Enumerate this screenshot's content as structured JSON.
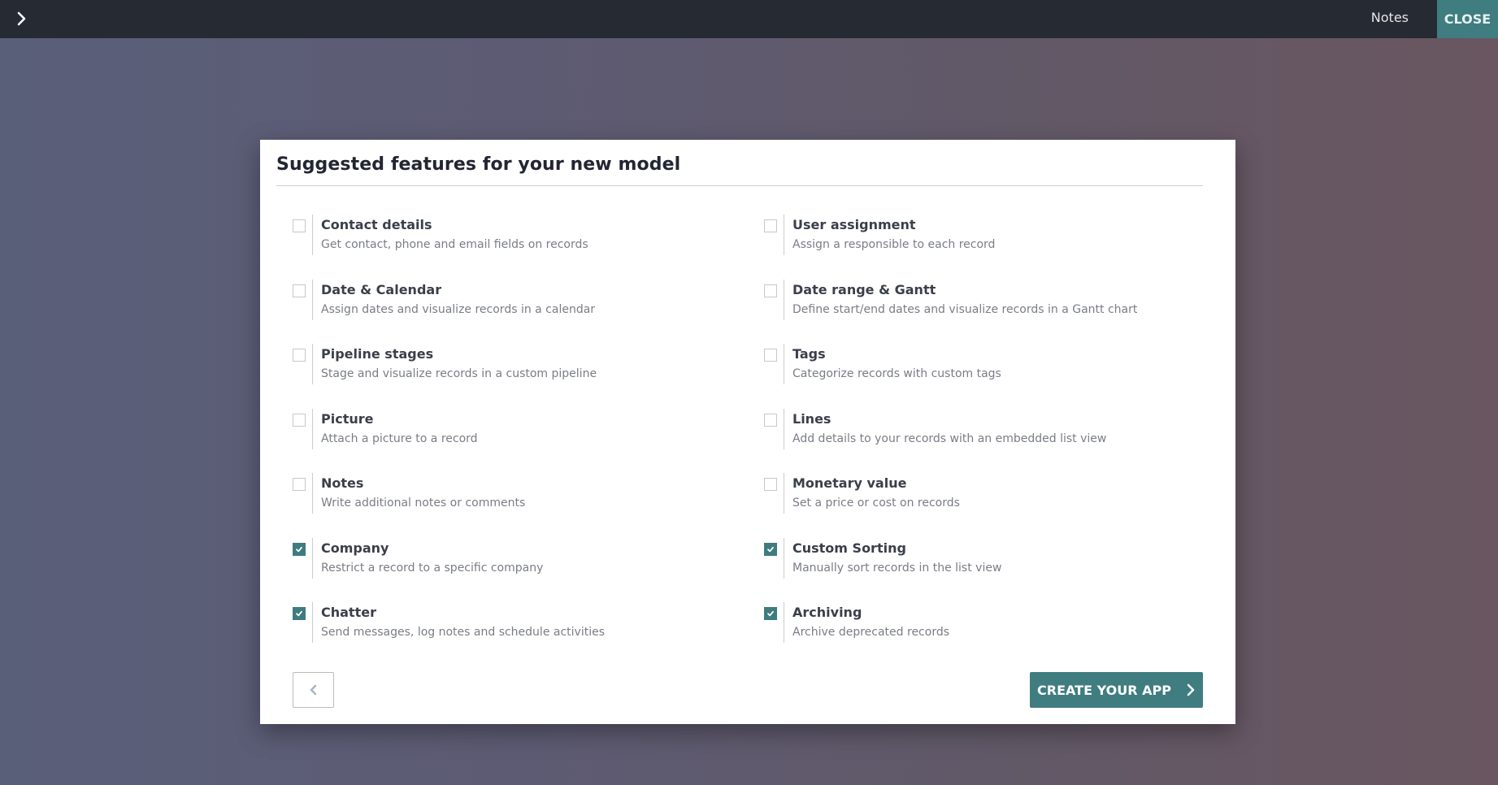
{
  "topbar": {
    "toggle_icon": "chevron-right-icon",
    "notes_label": "Notes",
    "close_label": "CLOSE"
  },
  "modal": {
    "title": "Suggested features for your new model",
    "features_left": [
      {
        "title": "Contact details",
        "description": "Get contact, phone and email fields on records",
        "checked": false
      },
      {
        "title": "Date & Calendar",
        "description": "Assign dates and visualize records in a calendar",
        "checked": false
      },
      {
        "title": "Pipeline stages",
        "description": "Stage and visualize records in a custom pipeline",
        "checked": false
      },
      {
        "title": "Picture",
        "description": "Attach a picture to a record",
        "checked": false
      },
      {
        "title": "Notes",
        "description": "Write additional notes or comments",
        "checked": false
      },
      {
        "title": "Company",
        "description": "Restrict a record to a specific company",
        "checked": true
      },
      {
        "title": "Chatter",
        "description": "Send messages, log notes and schedule activities",
        "checked": true
      }
    ],
    "features_right": [
      {
        "title": "User assignment",
        "description": "Assign a responsible to each record",
        "checked": false
      },
      {
        "title": "Date range & Gantt",
        "description": "Define start/end dates and visualize records in a Gantt chart",
        "checked": false
      },
      {
        "title": "Tags",
        "description": "Categorize records with custom tags",
        "checked": false
      },
      {
        "title": "Lines",
        "description": "Add details to your records with an embedded list view",
        "checked": false
      },
      {
        "title": "Monetary value",
        "description": "Set a price or cost on records",
        "checked": false
      },
      {
        "title": "Custom Sorting",
        "description": "Manually sort records in the list view",
        "checked": true
      },
      {
        "title": "Archiving",
        "description": "Archive deprecated records",
        "checked": true
      }
    ],
    "back_icon": "chevron-left-icon",
    "create_label": "CREATE YOUR APP",
    "create_icon": "chevron-right-icon"
  },
  "colors": {
    "accent": "#3f7d80",
    "topbar": "#262a33"
  }
}
